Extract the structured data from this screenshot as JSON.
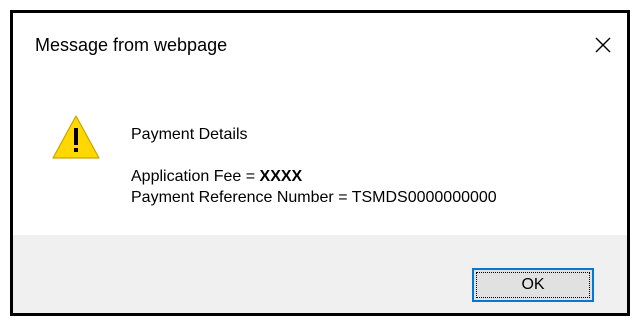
{
  "dialog": {
    "title": "Message from webpage",
    "close_icon": "close-icon",
    "warning_icon": "warning-icon",
    "message": {
      "heading": "Payment Details",
      "fee_label": "Application Fee = ",
      "fee_value": "XXXX",
      "reference_label": "Payment Reference Number = ",
      "reference_value": "TSMDS0000000000"
    },
    "ok_label": "OK",
    "colors": {
      "border": "#000000",
      "footer_bg": "#f0f0f0",
      "button_bg": "#e1e1e1",
      "button_focus": "#0078d7",
      "warning_fill": "#ffd800"
    }
  }
}
